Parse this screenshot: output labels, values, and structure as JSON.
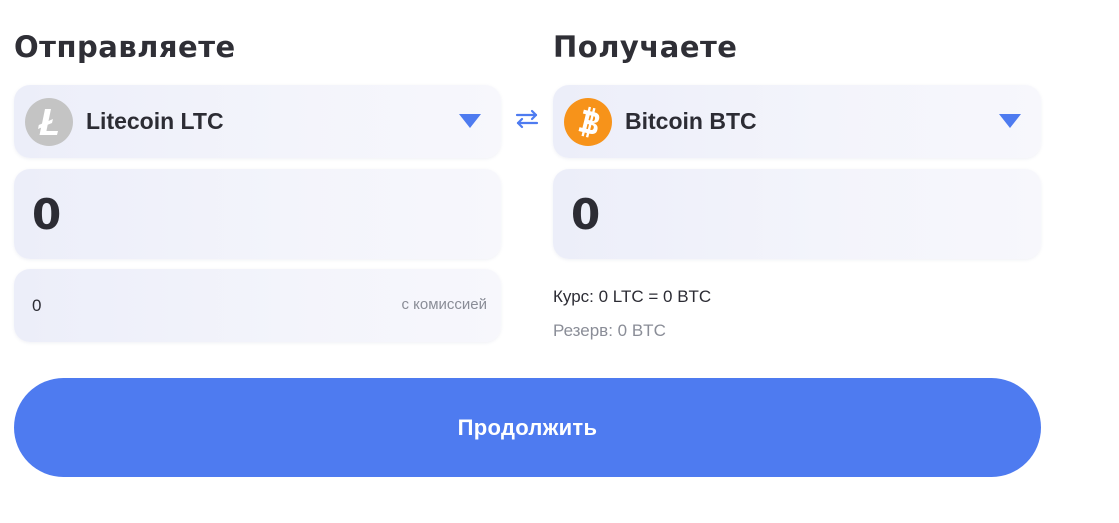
{
  "send": {
    "heading": "Отправляете",
    "currency": "Litecoin LTC",
    "coin_icon": "litecoin-icon",
    "amount": "0",
    "fee_amount": "0",
    "fee_label": "с комиссией"
  },
  "receive": {
    "heading": "Получаете",
    "currency": "Bitcoin BTC",
    "coin_icon": "bitcoin-icon",
    "amount": "0",
    "rate": "Курс: 0 LTC = 0 BTC",
    "reserve": "Резерв: 0 BTC"
  },
  "actions": {
    "continue_label": "Продолжить",
    "swap_icon": "swap-arrows-icon"
  },
  "colors": {
    "accent": "#4e7bf0",
    "ltc": "#c4c4c4",
    "btc": "#f7931a",
    "muted_text": "#8a8d97",
    "field_bg": "#eceef9"
  }
}
